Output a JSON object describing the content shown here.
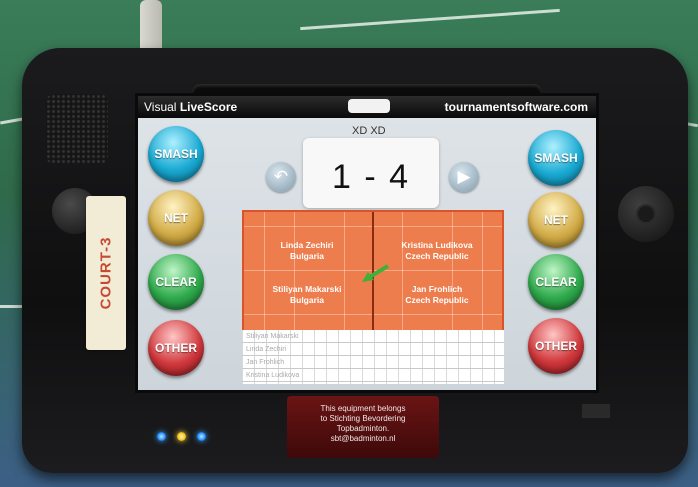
{
  "device": {
    "court_label": "COURT-3",
    "leds": [
      "blue",
      "yellow",
      "blue"
    ],
    "sticker_lines": [
      "This equipment belongs",
      "to Stichting Bevordering",
      "Topbadminton.",
      "sbt@badminton.nl"
    ]
  },
  "screen": {
    "brand_prefix": "Visual ",
    "brand_name": "LiveScore",
    "site": "tournamentsoftware.com",
    "event": "XD XD",
    "score": "1 - 4",
    "left_buttons": [
      "SMASH",
      "NET",
      "CLEAR",
      "OTHER"
    ],
    "right_buttons": [
      "SMASH",
      "NET",
      "CLEAR",
      "OTHER"
    ],
    "players": {
      "top_left": {
        "name": "Linda Zechiri",
        "country": "Bulgaria"
      },
      "top_right": {
        "name": "Kristina Ludikova",
        "country": "Czech Republic"
      },
      "bottom_left": {
        "name": "Stiliyan Makarski",
        "country": "Bulgaria"
      },
      "bottom_right": {
        "name": "Jan Frohlich",
        "country": "Czech Republic"
      }
    },
    "log_rows": [
      "Stiliyan Makarski",
      "Linda Zechiri",
      "Jan Frohlich",
      "Kristina Ludikova"
    ]
  },
  "colors": {
    "court": "#ee7d4e",
    "smash": "#19a9d2",
    "net": "#d2ab46",
    "clear": "#2ea94b",
    "other": "#d0383c"
  }
}
